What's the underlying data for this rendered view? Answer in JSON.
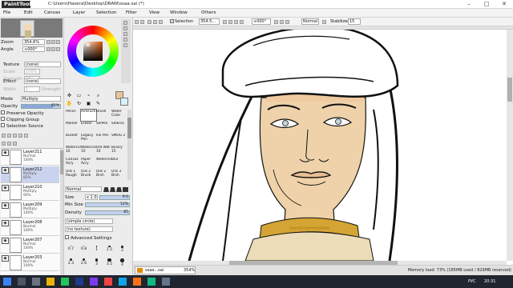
{
  "window": {
    "logo": "PaintTool SAI",
    "title_path": "C:\\Users\\Hasera\\Desktop\\DRAW\\ssaa.sai (*)"
  },
  "menu": [
    "File",
    "Edit",
    "Canvas",
    "Layer",
    "Selection",
    "Filter",
    "View",
    "Window",
    "Others"
  ],
  "navigator": {
    "zoom_label": "Zoom",
    "zoom_value": "354.6%",
    "angle_label": "Angle",
    "angle_value": "+000°"
  },
  "texture": {
    "label": "Texture",
    "value": "(none)",
    "scale": "Scale",
    "scale_val": "100%",
    "strength": "Strength",
    "strength_val": "20"
  },
  "effect": {
    "label": "Effect",
    "value": "(none)",
    "width": "Width",
    "width_val": "1",
    "strength": "Strength",
    "strength_val": "20"
  },
  "mode": {
    "label": "Mode",
    "value": "Multiply"
  },
  "opacity": {
    "label": "Opacity",
    "value": "82%"
  },
  "checks": [
    "Preserve Opacity",
    "Clipping Group",
    "Selection Source"
  ],
  "layers": [
    {
      "name": "Layer211",
      "mode": "Normal",
      "opacity": "100%",
      "selected": false
    },
    {
      "name": "Layer212",
      "mode": "Multiply",
      "opacity": "82%",
      "selected": true
    },
    {
      "name": "Layer210",
      "mode": "Multiply",
      "opacity": "90%",
      "selected": false
    },
    {
      "name": "Layer209",
      "mode": "Multiply",
      "opacity": "100%",
      "selected": false
    },
    {
      "name": "Layer208",
      "mode": "Normal",
      "opacity": "100%",
      "selected": false
    },
    {
      "name": "Layer207",
      "mode": "Normal",
      "opacity": "100%",
      "selected": false
    },
    {
      "name": "Layer203",
      "mode": "Normal",
      "opacity": "100%",
      "selected": false
    }
  ],
  "colors": {
    "primary": "#e9c39a",
    "secondary": "#d8f1ff"
  },
  "tools": [
    "✜",
    "▭",
    "∘",
    "⌕",
    "✋",
    "↻",
    "▣",
    "✎"
  ],
  "brushes": [
    {
      "name": "Pencil",
      "size": ""
    },
    {
      "name": "AirBrush",
      "size": ""
    },
    {
      "name": "Brush",
      "size": ""
    },
    {
      "name": "Water Color",
      "size": ""
    },
    {
      "name": "Marker",
      "size": ""
    },
    {
      "name": "Eraser",
      "size": ""
    },
    {
      "name": "SelPen",
      "size": ""
    },
    {
      "name": "SelEras",
      "size": ""
    },
    {
      "name": "Bucket",
      "size": ""
    },
    {
      "name": "Legacy Pen",
      "size": ""
    },
    {
      "name": "Ink Pen",
      "size": ""
    },
    {
      "name": "SMDG 2",
      "size": ""
    },
    {
      "name": "Watercol",
      "size": "10"
    },
    {
      "name": "Watercol",
      "size": "10"
    },
    {
      "name": "Old Wat",
      "size": "10"
    },
    {
      "name": "Binary",
      "size": "15"
    },
    {
      "name": "Canvas Acry",
      "size": ""
    },
    {
      "name": "Paper Acry",
      "size": ""
    },
    {
      "name": "Watercol",
      "size": ""
    },
    {
      "name": "Blur",
      "size": ""
    },
    {
      "name": "Oils 1 Rough",
      "size": ""
    },
    {
      "name": "Oils 2 Brush",
      "size": ""
    },
    {
      "name": "Oils 2 Brsh",
      "size": ""
    },
    {
      "name": "Oils 3 Brsh",
      "size": ""
    }
  ],
  "brush_settings": {
    "mode": "Normal",
    "size_label": "Size",
    "size_mult": "x 1.0",
    "size_val": "9.0",
    "minsize_label": "Min Size",
    "minsize_val": "12%",
    "density_label": "Density",
    "density_val": "85",
    "shape": "(simple circle)",
    "texture": "(no texture)",
    "advanced": "Advanced Settings",
    "presets": [
      "0.7",
      "0.8",
      "1",
      "1.5",
      "2",
      "2.3",
      "2.6",
      "3",
      "3.5",
      "4"
    ]
  },
  "canvas_toolbar": {
    "selection": "Selection",
    "zoom": "354.5...",
    "rotate": "+000°",
    "mode": "Normal",
    "stabilizer_label": "Stabilizer",
    "stabilizer_val": "15"
  },
  "tab": {
    "name": "ssaa...sai",
    "percent": "354%"
  },
  "status": {
    "memory": "Memory load: 73% (185MB used / 829MB reserved)"
  },
  "tray": {
    "lang": "РУС",
    "time": "20:31"
  },
  "accent": "#3b6fd1"
}
